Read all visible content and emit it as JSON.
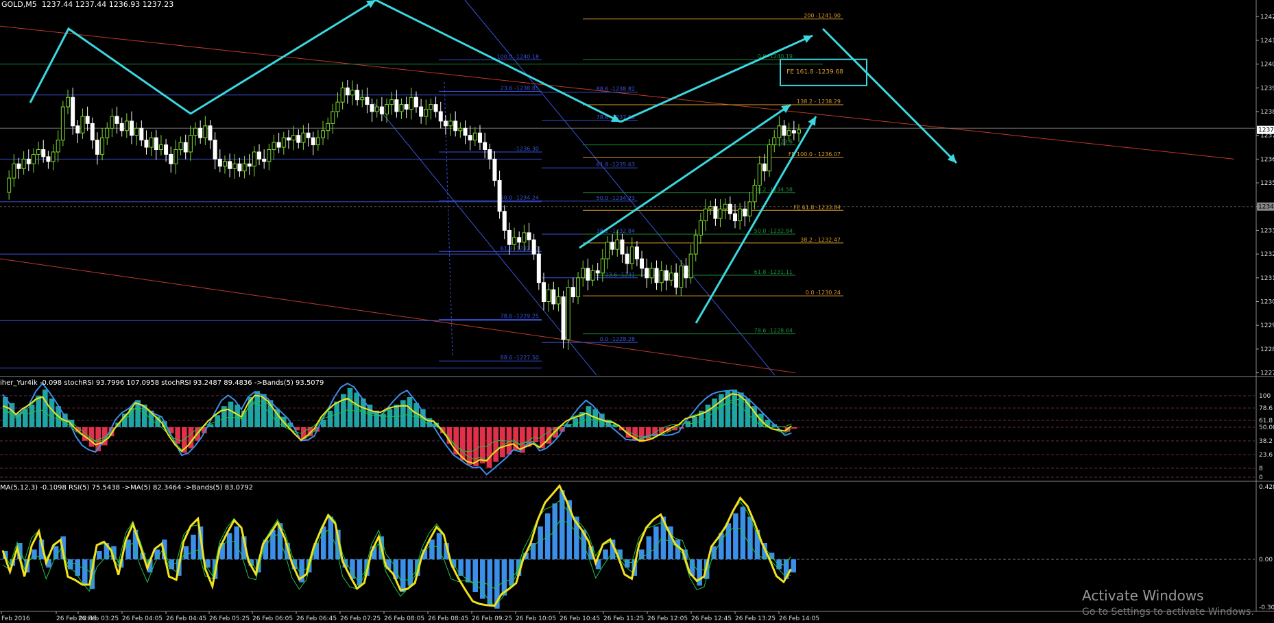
{
  "window": {
    "symbol_label": "GOLD,M5",
    "ohlc_label": "1237.44 1237.44 1236.93 1237.23"
  },
  "indicators": {
    "stoch_label": "iher_Yur4ik -0.098 stochRSI 93.7996 107.0958 stochRSI 93.2487 89.4836 ->Bands(5) 93.5079",
    "rsi_label": "MA(5,12,3) -0.1098 RSI(5) 75.5438 ->MA(5) 82.3464 ->Bands(5) 83.0792"
  },
  "watermark": {
    "line1": "Activate Windows",
    "line2": "Go to Settings to activate Windows."
  },
  "colors": {
    "background": "#000000",
    "bull_candle": "#7fdc2e",
    "bear_candle": "#ffffff",
    "arrow": "#3ad8e0",
    "fib_blue": "#3a52d8",
    "fib_green": "#1a8c3a",
    "fib_orange": "#d99b2b",
    "channel_red": "#c0392b",
    "teal_hist": "#1fa3a3",
    "red_hist": "#e0304a",
    "yellow_line": "#f2e21b",
    "blue_line": "#3b8fe8",
    "green_band": "#22c34a"
  },
  "chart_data": {
    "type": "candlestick",
    "symbol": "GOLD",
    "timeframe": "M5",
    "ylim": [
      1226.9,
      1242.7
    ],
    "y_ticks": [
      "1242",
      "1241",
      "1240",
      "1239",
      "1238",
      "1237",
      "1236",
      "1235",
      "1234",
      "1233",
      "1232",
      "1231",
      "1230",
      "1229",
      "1228",
      "1227"
    ],
    "price_marker": "1237.2",
    "price_marker2": "1234.",
    "x_ticks": [
      "Feb 2016",
      "26 Feb 02:45",
      "26 Feb 03:25",
      "26 Feb 04:05",
      "26 Feb 04:45",
      "26 Feb 05:25",
      "26 Feb 06:05",
      "26 Feb 06:45",
      "26 Feb 07:25",
      "26 Feb 08:05",
      "26 Feb 08:45",
      "26 Feb 09:25",
      "26 Feb 10:05",
      "26 Feb 10:45",
      "26 Feb 11:25",
      "26 Feb 12:05",
      "26 Feb 12:45",
      "26 Feb 13:25",
      "26 Feb 14:05"
    ],
    "close_path": [
      1234.6,
      1235.2,
      1235.8,
      1235.6,
      1236.0,
      1235.8,
      1236.2,
      1236.4,
      1236.1,
      1235.9,
      1236.3,
      1236.8,
      1238.2,
      1238.6,
      1237.4,
      1237.1,
      1237.8,
      1237.5,
      1236.8,
      1236.2,
      1236.9,
      1237.3,
      1237.8,
      1237.5,
      1237.2,
      1237.6,
      1237.0,
      1237.3,
      1236.8,
      1236.5,
      1236.9,
      1236.4,
      1236.6,
      1236.2,
      1235.8,
      1236.4,
      1236.7,
      1236.3,
      1237.0,
      1237.3,
      1236.9,
      1237.4,
      1236.8,
      1236.0,
      1235.7,
      1235.9,
      1235.6,
      1235.8,
      1235.5,
      1235.8,
      1235.7,
      1236.3,
      1236.0,
      1235.9,
      1236.4,
      1236.7,
      1236.5,
      1236.9,
      1236.8,
      1237.0,
      1236.7,
      1237.1,
      1236.9,
      1236.6,
      1236.9,
      1237.2,
      1237.5,
      1238.0,
      1238.4,
      1239.0,
      1238.7,
      1238.9,
      1238.5,
      1238.6,
      1238.3,
      1238.0,
      1238.2,
      1237.9,
      1238.3,
      1238.5,
      1238.0,
      1238.3,
      1238.1,
      1238.6,
      1238.2,
      1237.8,
      1238.1,
      1238.3,
      1238.0,
      1237.6,
      1237.4,
      1237.6,
      1237.2,
      1237.3,
      1237.0,
      1236.8,
      1237.1,
      1236.7,
      1236.4,
      1236.0,
      1235.1,
      1233.8,
      1233.0,
      1232.4,
      1232.7,
      1232.5,
      1232.9,
      1232.6,
      1232.0,
      1230.8,
      1230.0,
      1230.5,
      1229.9,
      1230.2,
      1228.4,
      1230.6,
      1230.2,
      1231.0,
      1231.4,
      1230.9,
      1231.3,
      1231.2,
      1231.8,
      1232.5,
      1232.2,
      1232.6,
      1232.0,
      1231.6,
      1232.3,
      1231.8,
      1231.4,
      1231.0,
      1231.4,
      1230.8,
      1231.3,
      1230.9,
      1231.2,
      1230.6,
      1231.5,
      1231.0,
      1232.0,
      1232.8,
      1233.4,
      1233.9,
      1234.0,
      1233.5,
      1233.9,
      1234.1,
      1233.7,
      1233.4,
      1233.9,
      1233.6,
      1234.2,
      1234.9,
      1235.8,
      1235.5,
      1236.6,
      1236.9,
      1237.4,
      1237.0,
      1237.2,
      1237.1,
      1237.23
    ],
    "stoch_hist": [
      40,
      32,
      18,
      24,
      30,
      42,
      50,
      38,
      28,
      18,
      10,
      -6,
      -18,
      -26,
      -32,
      -24,
      -12,
      6,
      18,
      26,
      36,
      30,
      22,
      14,
      8,
      -8,
      -22,
      -34,
      -28,
      -18,
      -8,
      4,
      16,
      28,
      34,
      30,
      22,
      40,
      48,
      44,
      36,
      24,
      14,
      6,
      -4,
      -16,
      -12,
      -6,
      10,
      22,
      34,
      44,
      52,
      46,
      38,
      30,
      22,
      18,
      24,
      30,
      36,
      40,
      32,
      24,
      12,
      6,
      -8,
      -22,
      -36,
      -44,
      -50,
      -52,
      -48,
      -54,
      -46,
      -40,
      -36,
      -30,
      -34,
      -26,
      -20,
      -28,
      -22,
      -14,
      -6,
      4,
      12,
      20,
      28,
      24,
      18,
      10,
      4,
      -4,
      -14,
      -18,
      -20,
      -16,
      -12,
      -8,
      -6,
      -4,
      -2,
      8,
      14,
      22,
      30,
      38,
      44,
      48,
      50,
      46,
      38,
      28,
      18,
      10,
      4,
      0,
      -6,
      -2
    ],
    "rsi_hist": [
      0.05,
      -0.04,
      0.1,
      -0.08,
      0.06,
      0.12,
      -0.05,
      0.08,
      0.14,
      -0.06,
      -0.1,
      -0.16,
      -0.18,
      0.05,
      0.1,
      0.08,
      -0.05,
      0.12,
      0.18,
      0.04,
      -0.08,
      0.06,
      0.12,
      -0.06,
      -0.1,
      0.08,
      0.15,
      0.2,
      -0.05,
      -0.12,
      0.1,
      0.16,
      0.2,
      0.14,
      -0.04,
      -0.08,
      0.12,
      0.18,
      0.22,
      0.1,
      -0.06,
      -0.14,
      -0.08,
      0.1,
      0.2,
      0.26,
      0.18,
      -0.05,
      -0.12,
      -0.16,
      -0.1,
      0.08,
      0.14,
      -0.06,
      -0.12,
      -0.2,
      -0.16,
      -0.1,
      0.06,
      0.12,
      0.16,
      0.1,
      -0.05,
      -0.1,
      -0.14,
      -0.2,
      -0.24,
      -0.28,
      -0.3,
      -0.22,
      -0.16,
      -0.1,
      0.04,
      0.1,
      0.2,
      0.28,
      0.34,
      0.42,
      0.36,
      0.26,
      0.18,
      0.08,
      -0.06,
      0.06,
      0.12,
      0.06,
      -0.05,
      -0.1,
      0.06,
      0.14,
      0.2,
      0.26,
      0.2,
      0.12,
      0.06,
      -0.1,
      -0.16,
      -0.12,
      0.08,
      0.16,
      0.22,
      0.28,
      0.32,
      0.26,
      0.18,
      0.1,
      0.04,
      -0.06,
      -0.12,
      -0.08
    ]
  }
}
